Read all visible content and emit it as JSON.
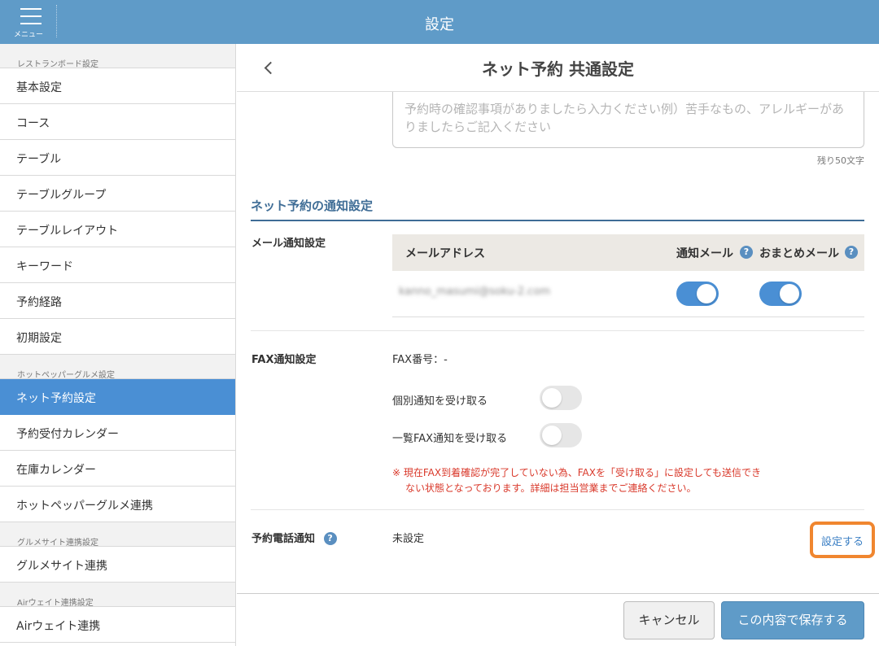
{
  "topbar": {
    "menu_label": "メニュー",
    "title": "設定"
  },
  "sidebar": {
    "sections": [
      {
        "title": "レストランボード設定",
        "items": [
          "基本設定",
          "コース",
          "テーブル",
          "テーブルグループ",
          "テーブルレイアウト",
          "キーワード",
          "予約経路",
          "初期設定"
        ]
      },
      {
        "title": "ホットペッパーグルメ設定",
        "items": [
          "ネット予約設定",
          "予約受付カレンダー",
          "在庫カレンダー",
          "ホットペッパーグルメ連携"
        ]
      },
      {
        "title": "グルメサイト連携設定",
        "items": [
          "グルメサイト連携"
        ]
      },
      {
        "title": "Airウェイト連携設定",
        "items": [
          "Airウェイト連携"
        ]
      }
    ],
    "active": "ネット予約設定"
  },
  "main": {
    "title": "ネット予約 共通設定",
    "textarea_placeholder": "予約時の確認事項がありましたら入力ください例）苦手なもの、アレルギーがありましたらご記入ください",
    "remaining": "残り50文字",
    "section_title": "ネット予約の通知設定",
    "mail": {
      "label": "メール通知設定",
      "col_address": "メールアドレス",
      "col_notify": "通知メール",
      "col_bundle": "おまとめメール",
      "help": "?",
      "email": "kanno_masumi@soku-2.com",
      "notify_on": true,
      "bundle_on": true
    },
    "fax": {
      "label": "FAX通知設定",
      "number": "FAX番号：-",
      "individual_label": "個別通知を受け取る",
      "individual_on": false,
      "list_label": "一覧FAX通知を受け取る",
      "list_on": false,
      "warning_line1": "※ 現在FAX到着確認が完了していない為、FAXを「受け取る」に設定しても送信でき",
      "warning_line2": "ない状態となっております。詳細は担当営業までご連絡ください。"
    },
    "phone": {
      "label": "予約電話通知",
      "help": "?",
      "status": "未設定",
      "link": "設定する"
    }
  },
  "footer": {
    "cancel": "キャンセル",
    "save": "この内容で保存する"
  },
  "colors": {
    "topbar": "#5f9bc8",
    "active": "#4a8fd4",
    "section": "#3f6d96",
    "warning": "#d9382a",
    "highlight": "#f0862f"
  }
}
